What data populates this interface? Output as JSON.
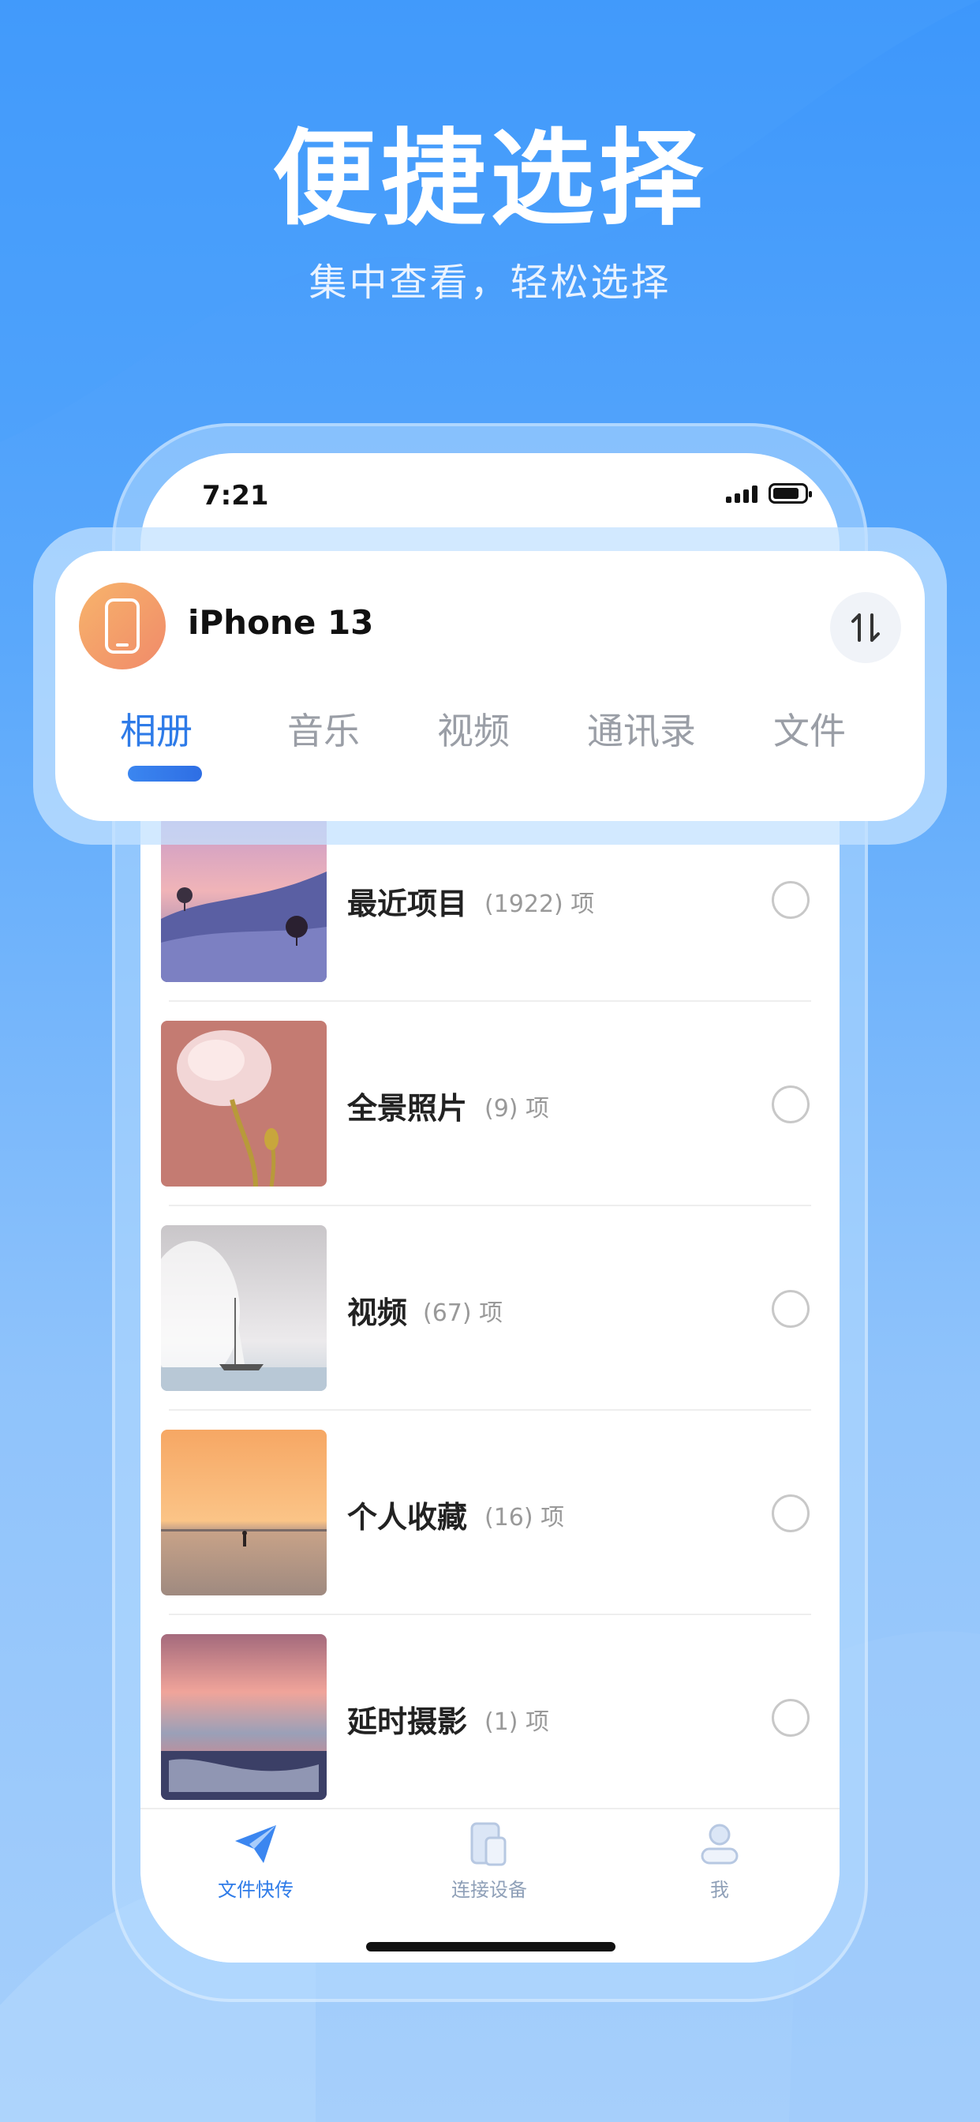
{
  "hero": {
    "title": "便捷选择",
    "subtitle": "集中查看，轻松选择"
  },
  "status_bar": {
    "time": "7:21"
  },
  "device": {
    "name": "iPhone 13"
  },
  "tabs": [
    {
      "label": "相册",
      "active": true
    },
    {
      "label": "音乐",
      "active": false
    },
    {
      "label": "视频",
      "active": false
    },
    {
      "label": "通讯录",
      "active": false
    },
    {
      "label": "文件",
      "active": false
    }
  ],
  "albums": [
    {
      "name": "最近项目",
      "count": "(1922) 项"
    },
    {
      "name": "全景照片",
      "count": "(9) 项"
    },
    {
      "name": "视频",
      "count": "(67) 项"
    },
    {
      "name": "个人收藏",
      "count": "(16) 项"
    },
    {
      "name": "延时摄影",
      "count": "(1) 项"
    }
  ],
  "bottom_nav": [
    {
      "label": "文件快传",
      "icon": "send-icon",
      "active": true
    },
    {
      "label": "连接设备",
      "icon": "devices-icon",
      "active": false
    },
    {
      "label": "我",
      "icon": "profile-icon",
      "active": false
    }
  ],
  "colors": {
    "accent": "#2e7be8",
    "background_top": "#3d97fb",
    "background_bottom": "#a6cffb"
  }
}
